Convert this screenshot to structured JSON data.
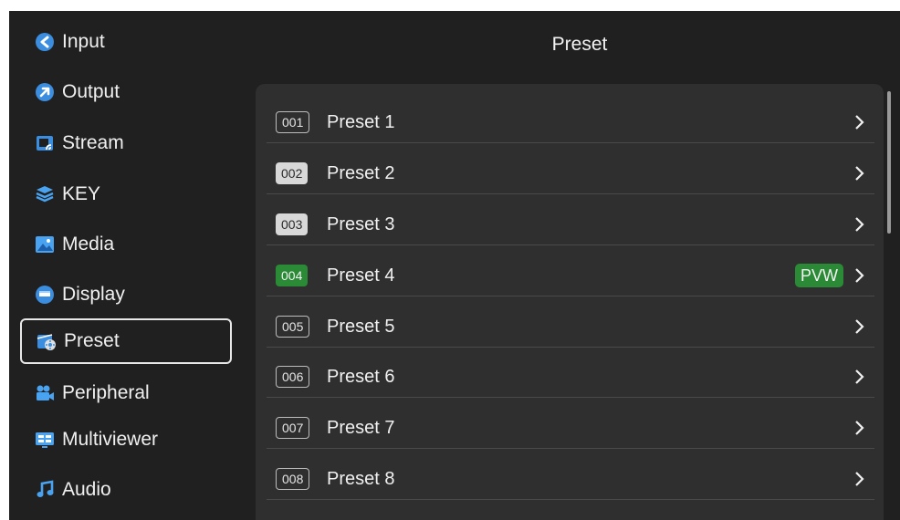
{
  "sidebar": {
    "items": [
      {
        "label": "Input",
        "icon": "input-icon"
      },
      {
        "label": "Output",
        "icon": "output-icon"
      },
      {
        "label": "Stream",
        "icon": "stream-icon"
      },
      {
        "label": "KEY",
        "icon": "key-layers-icon"
      },
      {
        "label": "Media",
        "icon": "media-image-icon"
      },
      {
        "label": "Display",
        "icon": "display-icon"
      },
      {
        "label": "Preset",
        "icon": "preset-icon",
        "selected": true
      },
      {
        "label": "Peripheral",
        "icon": "peripheral-camera-icon"
      },
      {
        "label": "Multiviewer",
        "icon": "multiviewer-icon"
      },
      {
        "label": "Audio",
        "icon": "audio-note-icon"
      }
    ]
  },
  "header": {
    "title": "Preset"
  },
  "presets": [
    {
      "index": "001",
      "name": "Preset 1",
      "state": "outline"
    },
    {
      "index": "002",
      "name": "Preset 2",
      "state": "filled"
    },
    {
      "index": "003",
      "name": "Preset 3",
      "state": "filled"
    },
    {
      "index": "004",
      "name": "Preset 4",
      "state": "pvw",
      "badge": "PVW"
    },
    {
      "index": "005",
      "name": "Preset 5",
      "state": "outline"
    },
    {
      "index": "006",
      "name": "Preset 6",
      "state": "outline"
    },
    {
      "index": "007",
      "name": "Preset 7",
      "state": "outline"
    },
    {
      "index": "008",
      "name": "Preset 8",
      "state": "outline"
    }
  ],
  "colors": {
    "background": "#202020",
    "panel": "#2f2f2f",
    "pvw_green": "#2a8a35",
    "text": "#f0f0f0"
  }
}
